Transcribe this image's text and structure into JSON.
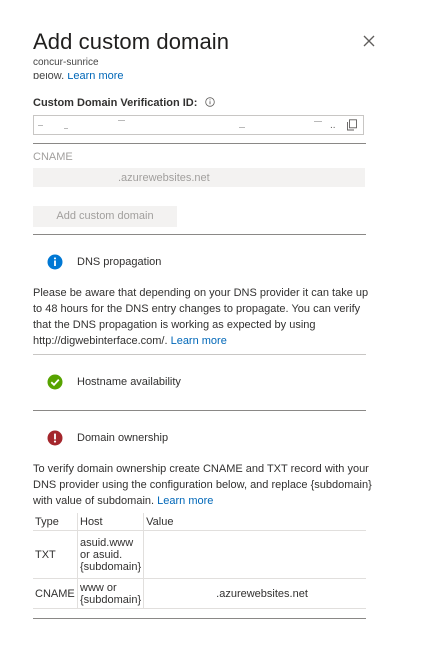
{
  "panel": {
    "title": "Add custom domain",
    "subtitle": "concur-sunrice",
    "intro_cut_text": "below.",
    "intro_link": "Learn more"
  },
  "verification": {
    "label": "Custom Domain Verification ID:",
    "info_icon": "info-circle-icon",
    "masked_marks": "..",
    "copy_icon": "copy-icon"
  },
  "cname": {
    "label": "CNAME",
    "value_suffix": ".azurewebsites.net"
  },
  "add_button": {
    "label": "Add custom domain"
  },
  "dns_propagation": {
    "icon": "info-filled-icon",
    "title": "DNS propagation",
    "text": "Please be aware that depending on your DNS provider it can take up to 48 hours for the DNS entry changes to propagate. You can verify that the DNS propagation is working as expected by using http://digwebinterface.com/.",
    "link": "Learn more"
  },
  "hostname": {
    "icon": "success-check-icon",
    "title": "Hostname availability"
  },
  "ownership": {
    "icon": "error-exclamation-icon",
    "title": "Domain ownership",
    "text": "To verify domain ownership create CNAME and TXT record with your DNS provider using the configuration below, and replace {subdomain} with value of subdomain.",
    "link": "Learn more"
  },
  "dns_table": {
    "headers": [
      "Type",
      "Host",
      "Value"
    ],
    "rows": [
      {
        "type": "TXT",
        "host": "asuid.www or asuid.{subdomain}",
        "value": ""
      },
      {
        "type": "CNAME",
        "host": "www or {subdomain}",
        "value": ".azurewebsites.net"
      }
    ]
  },
  "colors": {
    "link": "#0067b8",
    "info": "#0078d4",
    "success": "#57a300",
    "error": "#a4262c",
    "disabled_text": "#a19f9d"
  }
}
